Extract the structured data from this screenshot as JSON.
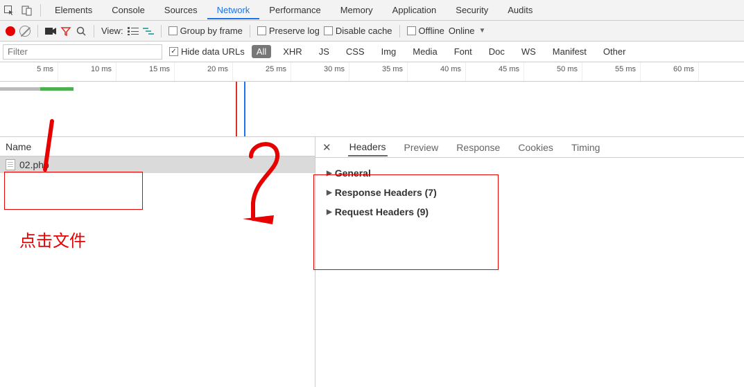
{
  "topTabs": {
    "elements": "Elements",
    "console": "Console",
    "sources": "Sources",
    "network": "Network",
    "performance": "Performance",
    "memory": "Memory",
    "application": "Application",
    "security": "Security",
    "audits": "Audits"
  },
  "toolbar": {
    "viewLabel": "View:",
    "groupByFrame": "Group by frame",
    "preserveLog": "Preserve log",
    "disableCache": "Disable cache",
    "offline": "Offline",
    "online": "Online"
  },
  "filter": {
    "placeholder": "Filter",
    "hideDataUrls": "Hide data URLs",
    "types": {
      "all": "All",
      "xhr": "XHR",
      "js": "JS",
      "css": "CSS",
      "img": "Img",
      "media": "Media",
      "font": "Font",
      "doc": "Doc",
      "ws": "WS",
      "manifest": "Manifest",
      "other": "Other"
    }
  },
  "timeline": {
    "t1": "5 ms",
    "t2": "10 ms",
    "t3": "15 ms",
    "t4": "20 ms",
    "t5": "25 ms",
    "t6": "30 ms",
    "t7": "35 ms",
    "t8": "40 ms",
    "t9": "45 ms",
    "t10": "50 ms",
    "t11": "55 ms",
    "t12": "60 ms"
  },
  "requestList": {
    "header": "Name",
    "rows": [
      {
        "name": "02.php"
      }
    ]
  },
  "detailTabs": {
    "headers": "Headers",
    "preview": "Preview",
    "response": "Response",
    "cookies": "Cookies",
    "timing": "Timing"
  },
  "headerSections": {
    "general": "General",
    "responseHeaders": "Response Headers (7)",
    "requestHeaders": "Request Headers (9)"
  },
  "annotations": {
    "clickFile": "点击文件"
  }
}
